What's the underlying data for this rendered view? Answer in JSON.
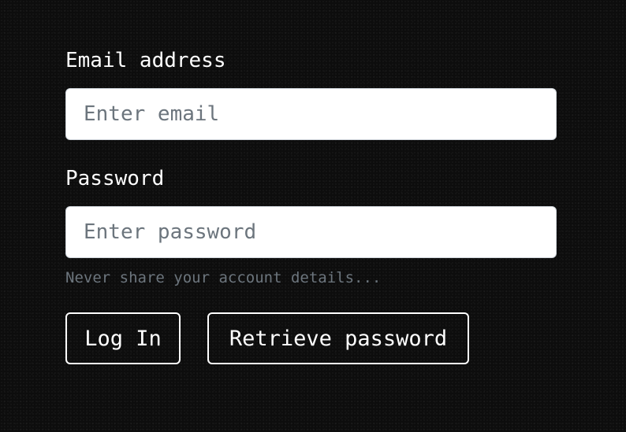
{
  "form": {
    "email": {
      "label": "Email address",
      "placeholder": "Enter email",
      "value": ""
    },
    "password": {
      "label": "Password",
      "placeholder": "Enter password",
      "value": ""
    },
    "help_text": "Never share your account details...",
    "buttons": {
      "login_label": "Log In",
      "retrieve_label": "Retrieve password"
    }
  },
  "colors": {
    "background": "#0d0d0d",
    "text": "#ffffff",
    "muted_text": "#6c757d",
    "input_background": "#ffffff",
    "input_border": "#ced4da"
  }
}
